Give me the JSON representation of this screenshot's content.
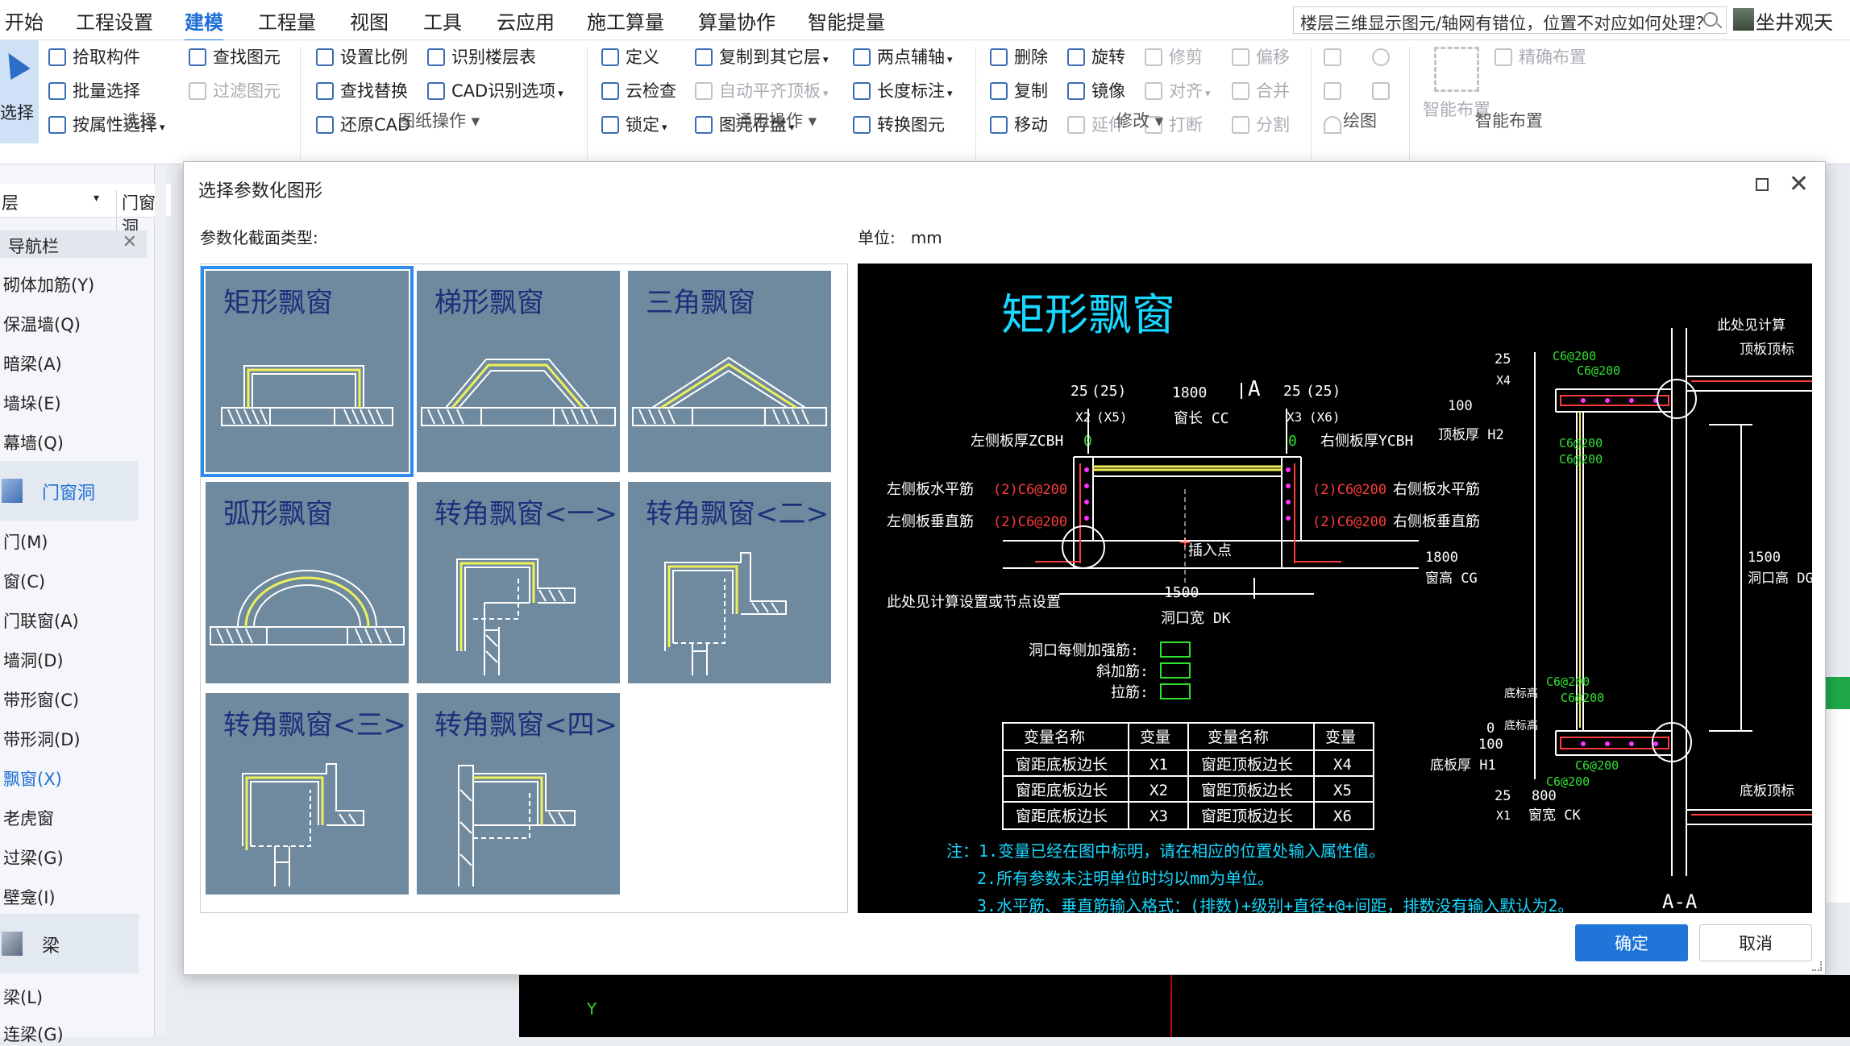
{
  "menu": {
    "items": [
      "开始",
      "工程设置",
      "建模",
      "工程量",
      "视图",
      "工具",
      "云应用",
      "施工算量",
      "算量协作",
      "智能提量"
    ],
    "active_index": 2,
    "search_text": "楼层三维显示图元/轴网有错位，位置不对应如何处理？",
    "user": "坐井观天"
  },
  "ribbon": {
    "select": {
      "big": "选择",
      "pick": "拾取构件",
      "batch": "批量选择",
      "by_attr": "按属性选择",
      "find": "查找图元",
      "filter": "过滤图元",
      "group": "选择"
    },
    "drawing": {
      "scale": "设置比例",
      "find_replace": "查找替换",
      "restore": "还原CAD",
      "recognize_floor": "识别楼层表",
      "cad_options": "CAD识别选项",
      "group": "图纸操作"
    },
    "common": {
      "define": "定义",
      "cloud_check": "云检查",
      "lock": "锁定",
      "copy_to_layer": "复制到其它层",
      "auto_flat": "自动平齐顶板",
      "save_elem": "图元存盘",
      "two_point_axis": "两点辅轴",
      "length_mark": "长度标注",
      "convert_elem": "转换图元",
      "group": "通用操作"
    },
    "modify": {
      "delete": "删除",
      "copy": "复制",
      "move": "移动",
      "rotate": "旋转",
      "mirror": "镜像",
      "extend": "延伸",
      "trim": "修剪",
      "align": "对齐",
      "break": "打断",
      "offset": "偏移",
      "merge": "合并",
      "split": "分割",
      "group": "修改"
    },
    "draw": {
      "group": "绘图"
    },
    "smart": {
      "big": "智能布置",
      "exact": "精确布置",
      "group": "智能布置"
    }
  },
  "leftpane": {
    "layer": "层",
    "category": "门窗洞",
    "nav_title": "导航栏",
    "items_top": [
      "砌体加筋(Y)",
      "保温墙(Q)",
      "暗梁(A)",
      "墙垛(E)",
      "幕墙(Q)"
    ],
    "cat1": "门窗洞",
    "items_mid": [
      "门(M)",
      "窗(C)",
      "门联窗(A)",
      "墙洞(D)",
      "带形窗(C)",
      "带形洞(D)",
      "飘窗(X)",
      "老虎窗",
      "过梁(G)",
      "壁龛(I)"
    ],
    "cat2": "梁",
    "items_bot": [
      "梁(L)",
      "连梁(G)"
    ]
  },
  "dialog": {
    "title": "选择参数化图形",
    "type_label": "参数化截面类型:",
    "unit_label": "单位:",
    "unit": "mm",
    "tiles": [
      "矩形飘窗",
      "梯形飘窗",
      "三角飘窗",
      "弧形飘窗",
      "转角飘窗<一>",
      "转角飘窗<二>",
      "转角飘窗<三>",
      "转角飘窗<四>"
    ],
    "selected_index": 0,
    "ok": "确定",
    "cancel": "取消"
  },
  "cad": {
    "title": "矩形飘窗",
    "t25a": "25",
    "t25b": "(25)",
    "t1800": "1800",
    "tA": "A",
    "t25c": "25",
    "t25d": "(25)",
    "x2": "X2",
    "x5": "(X5)",
    "window_len": "窗长 CC",
    "x3": "X3",
    "x6": "(X6)",
    "left_thk": "左侧板厚ZCBH",
    "zero_l": "0",
    "zero_r": "0",
    "right_thk": "右侧板厚YCBH",
    "left_h": "左侧板水平筋",
    "left_h_val": "(2)C6@200",
    "right_h_val": "(2)C6@200",
    "right_h": "右侧板水平筋",
    "left_v": "左侧板垂直筋",
    "left_v_val": "(2)C6@200",
    "right_v_val": "(2)C6@200",
    "right_v": "右侧板垂直筋",
    "insert_pt": "插入点",
    "see_calc": "此处见计算设置或节点设置",
    "t1500": "1500",
    "hole_w": "洞口宽 DK",
    "hole_each": "洞口每侧加强筋:",
    "diag": "斜加筋:",
    "tie": "拉筋:",
    "table_head": [
      "变量名称",
      "变量",
      "变量名称",
      "变量"
    ],
    "table_rows": [
      [
        "窗距底板边长",
        "X1",
        "窗距顶板边长",
        "X4"
      ],
      [
        "窗距底板边长",
        "X2",
        "窗距顶板边长",
        "X5"
      ],
      [
        "窗距底板边长",
        "X3",
        "窗距顶板边长",
        "X6"
      ]
    ],
    "note1": "注：1.变量已经在图中标明，请在相应的位置处输入属性值。",
    "note2": "2.所有参数未注明单位时均以mm为单位。",
    "note3": "3.水平筋、垂直筋输入格式：(排数)+级别+直径+@+间距，排数没有输入默认为2。",
    "sec": {
      "see_calc2": "此处见计算",
      "top_edge": "顶板顶标",
      "c6_1": "C6@200",
      "c6_2": "C6@200",
      "c6_3": "C6@200",
      "c6_4": "C6@200",
      "c6_5": "C6@200",
      "c6_6": "C6@200",
      "c6_7": "C6@200",
      "c6_8": "C6@200",
      "t25": "25",
      "x4": "X4",
      "t100": "100",
      "top_thk": "顶板厚 H2",
      "t1800": "1800",
      "win_h": "窗高 CG",
      "t1500": "1500",
      "hole_h": "洞口高 DG",
      "bot_elev1": "底标高",
      "bot_elev2": "底标高",
      "t0": "0",
      "t100b": "100",
      "bot_thk": "底板厚 H1",
      "bot_edge": "底板顶标",
      "t25b": "25",
      "t800": "800",
      "x1": "X1",
      "win_w": "窗宽 CK",
      "aa": "A-A"
    }
  }
}
